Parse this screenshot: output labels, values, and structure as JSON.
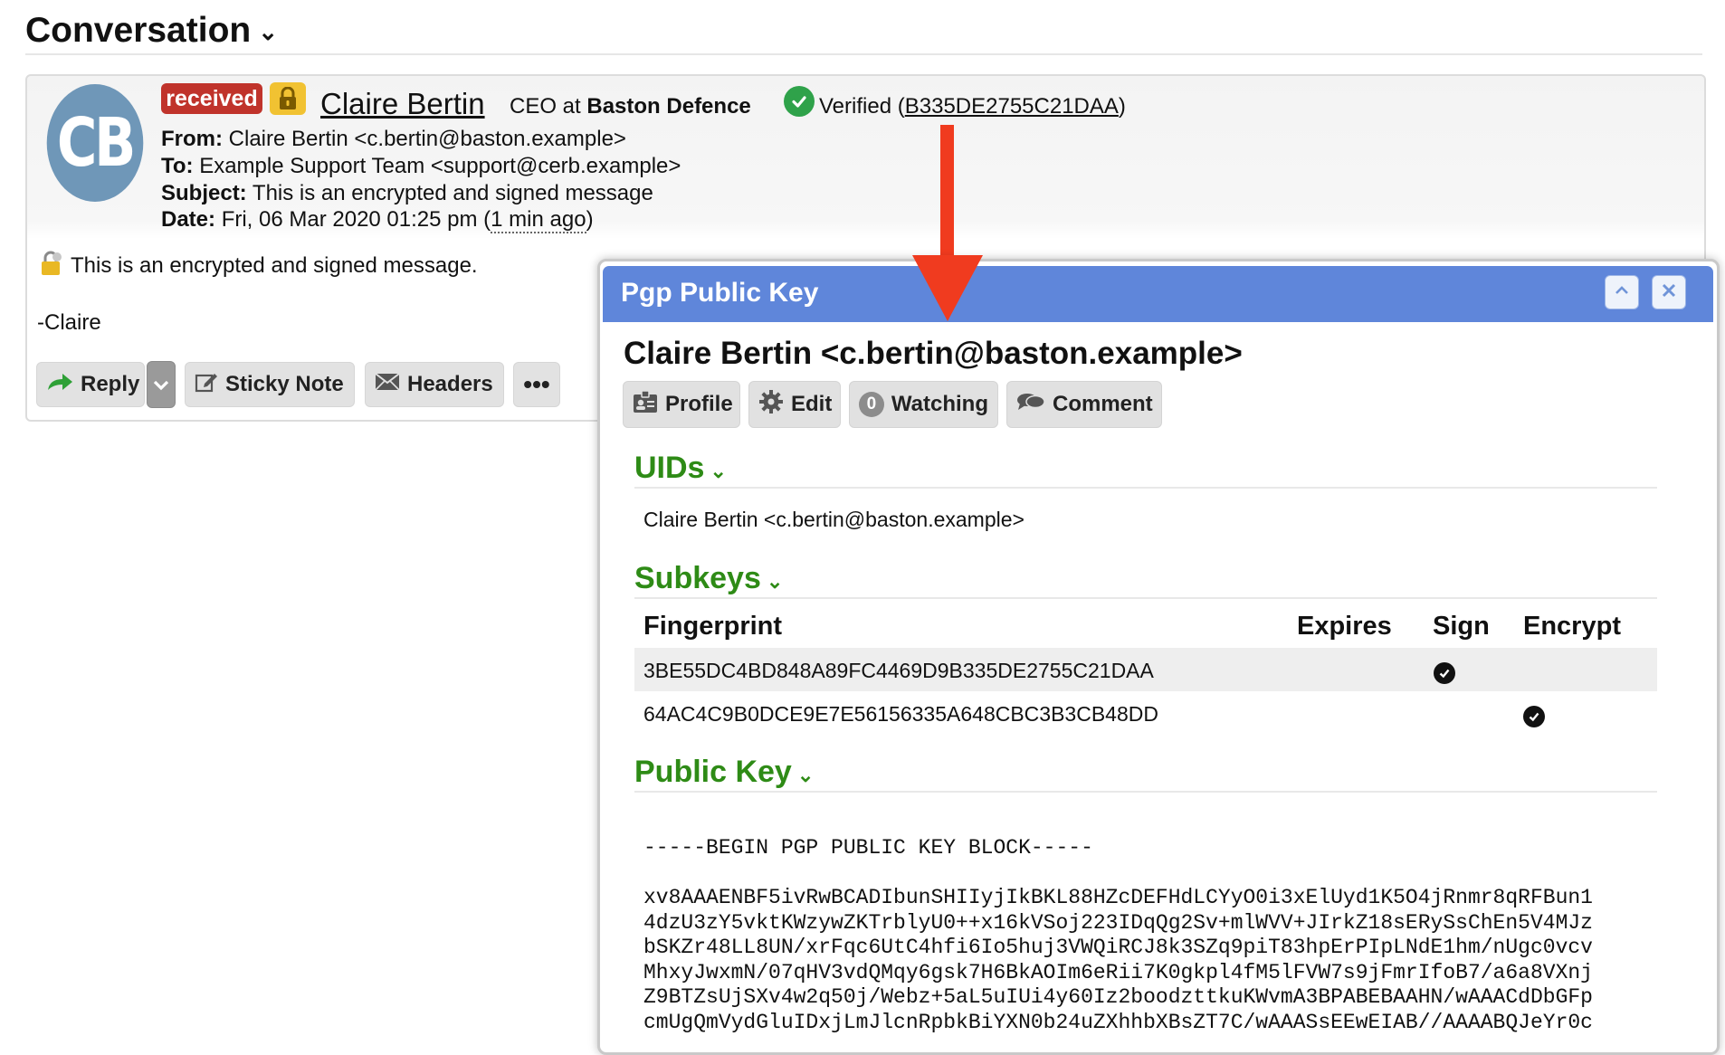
{
  "conversation": {
    "title": "Conversation",
    "chevron": "⌄"
  },
  "message": {
    "avatar_initials": "CB",
    "badge_received": "received",
    "sender_name": "Claire Bertin",
    "sender_role": "CEO at",
    "sender_org": "Baston Defence",
    "verified_label": "Verified",
    "verified_fingerprint": "B335DE2755C21DAA",
    "from_label": "From:",
    "from_value": "Claire Bertin <c.bertin@baston.example>",
    "to_label": "To:",
    "to_value": "Example Support Team <support@cerb.example>",
    "subject_label": "Subject:",
    "subject_value": "This is an encrypted and signed message",
    "date_label": "Date:",
    "date_value": "Fri, 06 Mar 2020 01:25 pm (",
    "date_ago": "1 min ago",
    "date_close": ")",
    "body_line1": "This is an encrypted and signed message.",
    "body_line2": "-Claire",
    "buttons": {
      "reply": "Reply",
      "sticky_note": "Sticky Note",
      "headers": "Headers",
      "more": "•••"
    }
  },
  "popup": {
    "title": "Pgp Public Key",
    "heading": "Claire Bertin <c.bertin@baston.example>",
    "buttons": {
      "profile": "Profile",
      "edit": "Edit",
      "watching_count": "0",
      "watching": "Watching",
      "comment": "Comment"
    },
    "uids_title": "UIDs",
    "uids": [
      "Claire Bertin <c.bertin@baston.example>"
    ],
    "subkeys_title": "Subkeys",
    "subkeys_columns": {
      "fingerprint": "Fingerprint",
      "expires": "Expires",
      "sign": "Sign",
      "encrypt": "Encrypt"
    },
    "subkeys": [
      {
        "fingerprint": "3BE55DC4BD848A89FC4469D9B335DE2755C21DAA",
        "expires": "",
        "sign": true,
        "encrypt": false
      },
      {
        "fingerprint": "64AC4C9B0DCE9E7E56156335A648CBC3B3CB48DD",
        "expires": "",
        "sign": false,
        "encrypt": true
      }
    ],
    "public_key_title": "Public Key",
    "public_key_block": "-----BEGIN PGP PUBLIC KEY BLOCK-----\n\nxv8AAAENBF5ivRwBCADIbunSHIIyjIkBKL88HZcDEFHdLCYyO0i3xElUyd1K5O4jRnmr8qRFBun1\n4dzU3zY5vktKWzywZKTrblyU0++x16kVSoj223IDqQg2Sv+mlWVV+JIrkZ18sERySsChEn5V4MJz\nbSKZr48LL8UN/xrFqc6UtC4hfi6Io5huj3VWQiRCJ8k3SZq9piT83hpErPIpLNdE1hm/nUgc0vcv\nMhxyJwxmN/07qHV3vdQMqy6gsk7H6BkAOIm6eRii7K0gkpl4fM5lFVW7s9jFmrIfoB7/a6a8VXnj\nZ9BTZsUjSXv4w2q50j/Webz+5aL5uIUi4y60Iz2boodzttkuKWvmA3BPABEBAAHN/wAAACdDbGFp\ncmUgQmVydGluIDxjLmJlcnRpbkBiYXN0b24uZXhhbXBsZT7C/wAAASsEEwEIAB//AAAABQJeYr0c"
  },
  "colors": {
    "received_badge": "#c0332b",
    "titlebar": "#5f86da",
    "section_green": "#2e8b16",
    "arrow": "#f03b1f",
    "verified_green": "#2fa24a"
  }
}
